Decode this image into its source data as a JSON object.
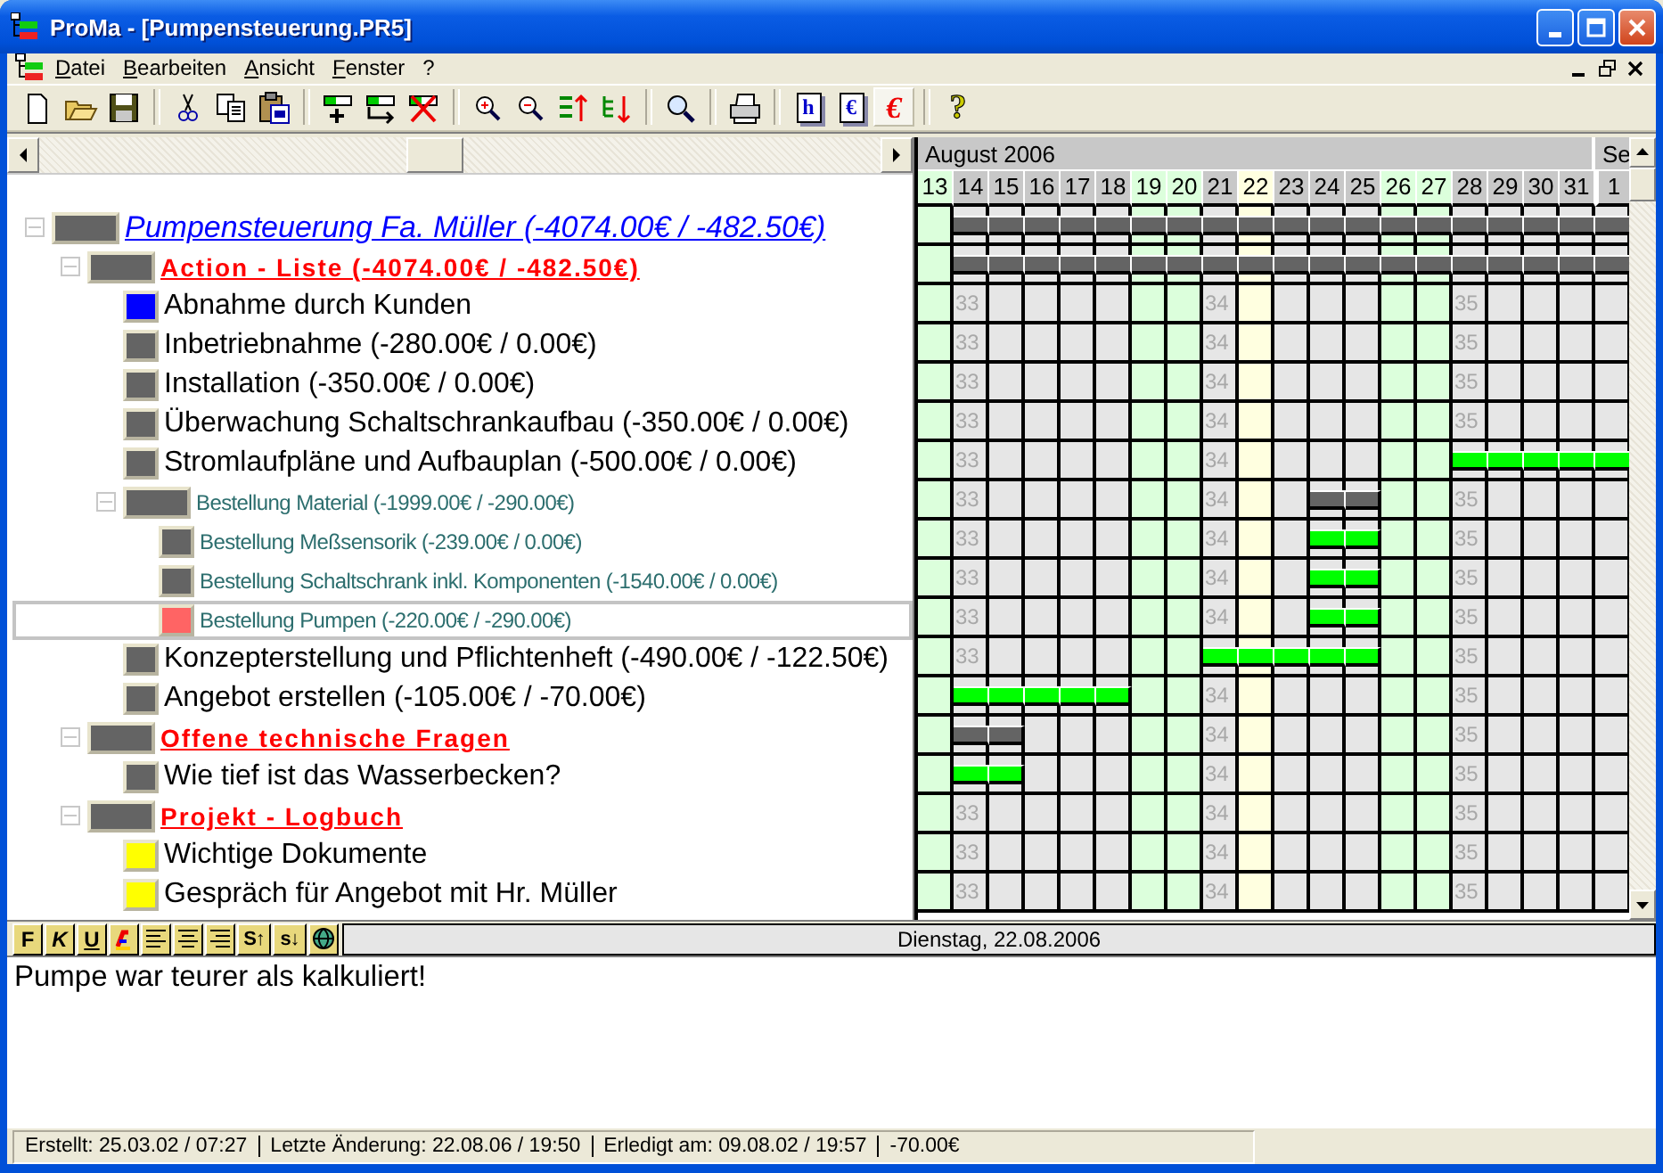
{
  "window": {
    "title": "ProMa - [Pumpensteuerung.PR5]"
  },
  "menu": [
    {
      "label": "Datei"
    },
    {
      "label": "Bearbeiten"
    },
    {
      "label": "Ansicht"
    },
    {
      "label": "Fenster"
    },
    {
      "label": "?"
    }
  ],
  "toolbar": [
    {
      "kind": "new",
      "pressed": false
    },
    {
      "kind": "open",
      "pressed": false
    },
    {
      "kind": "save",
      "pressed": false
    },
    {
      "kind": "separator"
    },
    {
      "kind": "cut",
      "pressed": false
    },
    {
      "kind": "copy",
      "pressed": false
    },
    {
      "kind": "paste",
      "pressed": false
    },
    {
      "kind": "separator"
    },
    {
      "kind": "add",
      "pressed": false
    },
    {
      "kind": "move",
      "pressed": false
    },
    {
      "kind": "delete",
      "pressed": false
    },
    {
      "kind": "separator"
    },
    {
      "kind": "zoom-in",
      "pressed": false
    },
    {
      "kind": "zoom-out",
      "pressed": false
    },
    {
      "kind": "sort-up",
      "pressed": false
    },
    {
      "kind": "sort-down",
      "pressed": false
    },
    {
      "kind": "separator"
    },
    {
      "kind": "find",
      "pressed": false
    },
    {
      "kind": "separator"
    },
    {
      "kind": "print",
      "pressed": false
    },
    {
      "kind": "separator"
    },
    {
      "kind": "report",
      "glyph": "h",
      "pressed": false
    },
    {
      "kind": "report",
      "glyph": "€",
      "pressed": false
    },
    {
      "kind": "currency",
      "glyph": "€",
      "pressed": true
    },
    {
      "kind": "separator"
    },
    {
      "kind": "help",
      "glyph": "?",
      "pressed": false
    }
  ],
  "tree": [
    {
      "label": "Pumpensteuerung Fa. Müller (-4074.00€ / -482.50€)",
      "kind": "project",
      "color": "#646464",
      "expanded": true,
      "selected": false,
      "children": [
        {
          "label": "Action - Liste (-4074.00€ / -482.50€)",
          "kind": "group",
          "color": "#646464",
          "expanded": true,
          "selected": false,
          "children": [
            {
              "label": "Abnahme durch Kunden",
              "kind": "task",
              "color": "#0000ff",
              "selected": false
            },
            {
              "label": "Inbetriebnahme (-280.00€ / 0.00€)",
              "kind": "task",
              "color": "#646464",
              "selected": false
            },
            {
              "label": "Installation (-350.00€ / 0.00€)",
              "kind": "task",
              "color": "#646464",
              "selected": false
            },
            {
              "label": "Überwachung Schaltschrankaufbau (-350.00€ / 0.00€)",
              "kind": "task",
              "color": "#646464",
              "selected": false
            },
            {
              "label": "Stromlaufpläne und Aufbauplan (-500.00€ / 0.00€)",
              "kind": "task",
              "color": "#646464",
              "selected": false
            },
            {
              "label": "Bestellung Material (-1999.00€ / -290.00€)",
              "kind": "subtask",
              "color": "#646464",
              "expanded": true,
              "selected": false,
              "children": [
                {
                  "label": "Bestellung Meßsensorik (-239.00€ / 0.00€)",
                  "kind": "subtask",
                  "color": "#646464",
                  "selected": false
                },
                {
                  "label": "Bestellung Schaltschrank inkl. Komponenten (-1540.00€ / 0.00€)",
                  "kind": "subtask",
                  "color": "#646464",
                  "selected": false
                },
                {
                  "label": "Bestellung Pumpen (-220.00€ / -290.00€)",
                  "kind": "subtask",
                  "color": "#ff6464",
                  "selected": true
                }
              ]
            },
            {
              "label": "Konzepterstellung und Pflichtenheft (-490.00€ / -122.50€)",
              "kind": "task",
              "color": "#646464",
              "selected": false
            },
            {
              "label": "Angebot erstellen (-105.00€ / -70.00€)",
              "kind": "task",
              "color": "#646464",
              "selected": false
            }
          ]
        },
        {
          "label": "Offene technische Fragen",
          "kind": "group",
          "color": "#646464",
          "expanded": true,
          "selected": false,
          "children": [
            {
              "label": "Wie tief ist das Wasserbecken?",
              "kind": "task",
              "color": "#646464",
              "selected": false
            }
          ]
        },
        {
          "label": "Projekt - Logbuch",
          "kind": "group",
          "color": "#646464",
          "expanded": true,
          "selected": false,
          "children": [
            {
              "label": "Wichtige Dokumente",
              "kind": "task",
              "color": "#ffff00",
              "selected": false
            },
            {
              "label": "Gespräch für Angebot mit Hr. Müller",
              "kind": "task",
              "color": "#ffff00",
              "selected": false
            }
          ]
        }
      ]
    }
  ],
  "gantt": {
    "months": [
      {
        "label": "August 2006"
      },
      {
        "label": "Se"
      }
    ],
    "days": [
      {
        "label": "13",
        "kind": "weekend"
      },
      {
        "label": "14",
        "kind": "weekday"
      },
      {
        "label": "15",
        "kind": "weekday"
      },
      {
        "label": "16",
        "kind": "weekday"
      },
      {
        "label": "17",
        "kind": "weekday"
      },
      {
        "label": "18",
        "kind": "weekday"
      },
      {
        "label": "19",
        "kind": "weekend"
      },
      {
        "label": "20",
        "kind": "weekend"
      },
      {
        "label": "21",
        "kind": "weekday"
      },
      {
        "label": "22",
        "kind": "today"
      },
      {
        "label": "23",
        "kind": "weekday"
      },
      {
        "label": "24",
        "kind": "weekday"
      },
      {
        "label": "25",
        "kind": "weekday"
      },
      {
        "label": "26",
        "kind": "weekend"
      },
      {
        "label": "27",
        "kind": "weekend"
      },
      {
        "label": "28",
        "kind": "weekday"
      },
      {
        "label": "29",
        "kind": "weekday"
      },
      {
        "label": "30",
        "kind": "weekday"
      },
      {
        "label": "31",
        "kind": "weekday"
      },
      {
        "label": "1",
        "kind": "weekday",
        "new_month": true
      }
    ],
    "rows": [
      {
        "color": "#646464",
        "cells": [
          {
            "bar": false
          },
          {
            "bar": true
          },
          {
            "bar": true
          },
          {
            "bar": true
          },
          {
            "bar": true
          },
          {
            "bar": true
          },
          {
            "bar": true
          },
          {
            "bar": true
          },
          {
            "bar": true
          },
          {
            "bar": true
          },
          {
            "bar": true
          },
          {
            "bar": true
          },
          {
            "bar": true
          },
          {
            "bar": true
          },
          {
            "bar": true
          },
          {
            "bar": true
          },
          {
            "bar": true
          },
          {
            "bar": true
          },
          {
            "bar": true
          },
          {
            "bar": true
          }
        ]
      },
      {
        "color": "#646464",
        "cells": [
          {
            "bar": false
          },
          {
            "bar": true
          },
          {
            "bar": true
          },
          {
            "bar": true
          },
          {
            "bar": true
          },
          {
            "bar": true
          },
          {
            "bar": true
          },
          {
            "bar": true
          },
          {
            "bar": true
          },
          {
            "bar": true
          },
          {
            "bar": true
          },
          {
            "bar": true
          },
          {
            "bar": true
          },
          {
            "bar": true
          },
          {
            "bar": true
          },
          {
            "bar": true
          },
          {
            "bar": true
          },
          {
            "bar": true
          },
          {
            "bar": true
          },
          {
            "bar": true
          }
        ]
      },
      {
        "cells": [
          {
            "bar": false
          },
          {
            "bar": false,
            "mark": "33"
          },
          {
            "bar": false
          },
          {
            "bar": false
          },
          {
            "bar": false
          },
          {
            "bar": false
          },
          {
            "bar": false
          },
          {
            "bar": false
          },
          {
            "bar": false,
            "mark": "34"
          },
          {
            "bar": false
          },
          {
            "bar": false
          },
          {
            "bar": false
          },
          {
            "bar": false
          },
          {
            "bar": false
          },
          {
            "bar": false
          },
          {
            "bar": false,
            "mark": "35"
          },
          {
            "bar": false
          },
          {
            "bar": false
          },
          {
            "bar": false
          },
          {
            "bar": false
          }
        ]
      },
      {
        "cells": [
          {
            "bar": false
          },
          {
            "bar": false,
            "mark": "33"
          },
          {
            "bar": false
          },
          {
            "bar": false
          },
          {
            "bar": false
          },
          {
            "bar": false
          },
          {
            "bar": false
          },
          {
            "bar": false
          },
          {
            "bar": false,
            "mark": "34"
          },
          {
            "bar": false
          },
          {
            "bar": false
          },
          {
            "bar": false
          },
          {
            "bar": false
          },
          {
            "bar": false
          },
          {
            "bar": false
          },
          {
            "bar": false,
            "mark": "35"
          },
          {
            "bar": false
          },
          {
            "bar": false
          },
          {
            "bar": false
          },
          {
            "bar": false
          }
        ]
      },
      {
        "cells": [
          {
            "bar": false
          },
          {
            "bar": false,
            "mark": "33"
          },
          {
            "bar": false
          },
          {
            "bar": false
          },
          {
            "bar": false
          },
          {
            "bar": false
          },
          {
            "bar": false
          },
          {
            "bar": false
          },
          {
            "bar": false,
            "mark": "34"
          },
          {
            "bar": false
          },
          {
            "bar": false
          },
          {
            "bar": false
          },
          {
            "bar": false
          },
          {
            "bar": false
          },
          {
            "bar": false
          },
          {
            "bar": false,
            "mark": "35"
          },
          {
            "bar": false
          },
          {
            "bar": false
          },
          {
            "bar": false
          },
          {
            "bar": false
          }
        ]
      },
      {
        "cells": [
          {
            "bar": false
          },
          {
            "bar": false,
            "mark": "33"
          },
          {
            "bar": false
          },
          {
            "bar": false
          },
          {
            "bar": false
          },
          {
            "bar": false
          },
          {
            "bar": false
          },
          {
            "bar": false
          },
          {
            "bar": false,
            "mark": "34"
          },
          {
            "bar": false
          },
          {
            "bar": false
          },
          {
            "bar": false
          },
          {
            "bar": false
          },
          {
            "bar": false
          },
          {
            "bar": false
          },
          {
            "bar": false,
            "mark": "35"
          },
          {
            "bar": false
          },
          {
            "bar": false
          },
          {
            "bar": false
          },
          {
            "bar": false
          }
        ]
      },
      {
        "color": "#00ff00",
        "cells": [
          {
            "bar": false
          },
          {
            "bar": false,
            "mark": "33"
          },
          {
            "bar": false
          },
          {
            "bar": false
          },
          {
            "bar": false
          },
          {
            "bar": false
          },
          {
            "bar": false
          },
          {
            "bar": false
          },
          {
            "bar": false,
            "mark": "34"
          },
          {
            "bar": false
          },
          {
            "bar": false
          },
          {
            "bar": false
          },
          {
            "bar": false
          },
          {
            "bar": false
          },
          {
            "bar": false
          },
          {
            "bar": true
          },
          {
            "bar": true
          },
          {
            "bar": true
          },
          {
            "bar": true
          },
          {
            "bar": true
          }
        ]
      },
      {
        "color": "#646464",
        "cells": [
          {
            "bar": false
          },
          {
            "bar": false,
            "mark": "33"
          },
          {
            "bar": false
          },
          {
            "bar": false
          },
          {
            "bar": false
          },
          {
            "bar": false
          },
          {
            "bar": false
          },
          {
            "bar": false
          },
          {
            "bar": false,
            "mark": "34"
          },
          {
            "bar": false
          },
          {
            "bar": false
          },
          {
            "bar": true
          },
          {
            "bar": true
          },
          {
            "bar": false
          },
          {
            "bar": false
          },
          {
            "bar": false,
            "mark": "35"
          },
          {
            "bar": false
          },
          {
            "bar": false
          },
          {
            "bar": false
          },
          {
            "bar": false
          }
        ]
      },
      {
        "color": "#00ff00",
        "cells": [
          {
            "bar": false
          },
          {
            "bar": false,
            "mark": "33"
          },
          {
            "bar": false
          },
          {
            "bar": false
          },
          {
            "bar": false
          },
          {
            "bar": false
          },
          {
            "bar": false
          },
          {
            "bar": false
          },
          {
            "bar": false,
            "mark": "34"
          },
          {
            "bar": false
          },
          {
            "bar": false
          },
          {
            "bar": true
          },
          {
            "bar": true
          },
          {
            "bar": false
          },
          {
            "bar": false
          },
          {
            "bar": false,
            "mark": "35"
          },
          {
            "bar": false
          },
          {
            "bar": false
          },
          {
            "bar": false
          },
          {
            "bar": false
          }
        ]
      },
      {
        "color": "#00ff00",
        "cells": [
          {
            "bar": false
          },
          {
            "bar": false,
            "mark": "33"
          },
          {
            "bar": false
          },
          {
            "bar": false
          },
          {
            "bar": false
          },
          {
            "bar": false
          },
          {
            "bar": false
          },
          {
            "bar": false
          },
          {
            "bar": false,
            "mark": "34"
          },
          {
            "bar": false
          },
          {
            "bar": false
          },
          {
            "bar": true
          },
          {
            "bar": true
          },
          {
            "bar": false
          },
          {
            "bar": false
          },
          {
            "bar": false,
            "mark": "35"
          },
          {
            "bar": false
          },
          {
            "bar": false
          },
          {
            "bar": false
          },
          {
            "bar": false
          }
        ]
      },
      {
        "color": "#00ff00",
        "cells": [
          {
            "bar": false
          },
          {
            "bar": false,
            "mark": "33"
          },
          {
            "bar": false
          },
          {
            "bar": false
          },
          {
            "bar": false
          },
          {
            "bar": false
          },
          {
            "bar": false
          },
          {
            "bar": false
          },
          {
            "bar": false,
            "mark": "34"
          },
          {
            "bar": false
          },
          {
            "bar": false
          },
          {
            "bar": true
          },
          {
            "bar": true
          },
          {
            "bar": false
          },
          {
            "bar": false
          },
          {
            "bar": false,
            "mark": "35"
          },
          {
            "bar": false
          },
          {
            "bar": false
          },
          {
            "bar": false
          },
          {
            "bar": false
          }
        ]
      },
      {
        "color": "#00ff00",
        "cells": [
          {
            "bar": false
          },
          {
            "bar": false,
            "mark": "33"
          },
          {
            "bar": false
          },
          {
            "bar": false
          },
          {
            "bar": false
          },
          {
            "bar": false
          },
          {
            "bar": false
          },
          {
            "bar": false
          },
          {
            "bar": true
          },
          {
            "bar": true
          },
          {
            "bar": true
          },
          {
            "bar": true
          },
          {
            "bar": true
          },
          {
            "bar": false
          },
          {
            "bar": false
          },
          {
            "bar": false,
            "mark": "35"
          },
          {
            "bar": false
          },
          {
            "bar": false
          },
          {
            "bar": false
          },
          {
            "bar": false
          }
        ]
      },
      {
        "color": "#00ff00",
        "cells": [
          {
            "bar": false
          },
          {
            "bar": true
          },
          {
            "bar": true
          },
          {
            "bar": true
          },
          {
            "bar": true
          },
          {
            "bar": true
          },
          {
            "bar": false
          },
          {
            "bar": false
          },
          {
            "bar": false,
            "mark": "34"
          },
          {
            "bar": false
          },
          {
            "bar": false
          },
          {
            "bar": false
          },
          {
            "bar": false
          },
          {
            "bar": false
          },
          {
            "bar": false
          },
          {
            "bar": false,
            "mark": "35"
          },
          {
            "bar": false
          },
          {
            "bar": false
          },
          {
            "bar": false
          },
          {
            "bar": false
          }
        ]
      },
      {
        "color": "#646464",
        "cells": [
          {
            "bar": false
          },
          {
            "bar": true
          },
          {
            "bar": true
          },
          {
            "bar": false
          },
          {
            "bar": false
          },
          {
            "bar": false
          },
          {
            "bar": false
          },
          {
            "bar": false
          },
          {
            "bar": false,
            "mark": "34"
          },
          {
            "bar": false
          },
          {
            "bar": false
          },
          {
            "bar": false
          },
          {
            "bar": false
          },
          {
            "bar": false
          },
          {
            "bar": false
          },
          {
            "bar": false,
            "mark": "35"
          },
          {
            "bar": false
          },
          {
            "bar": false
          },
          {
            "bar": false
          },
          {
            "bar": false
          }
        ]
      },
      {
        "color": "#00ff00",
        "cells": [
          {
            "bar": false
          },
          {
            "bar": true
          },
          {
            "bar": true
          },
          {
            "bar": false
          },
          {
            "bar": false
          },
          {
            "bar": false
          },
          {
            "bar": false
          },
          {
            "bar": false
          },
          {
            "bar": false,
            "mark": "34"
          },
          {
            "bar": false
          },
          {
            "bar": false
          },
          {
            "bar": false
          },
          {
            "bar": false
          },
          {
            "bar": false
          },
          {
            "bar": false
          },
          {
            "bar": false,
            "mark": "35"
          },
          {
            "bar": false
          },
          {
            "bar": false
          },
          {
            "bar": false
          },
          {
            "bar": false
          }
        ]
      },
      {
        "cells": [
          {
            "bar": false
          },
          {
            "bar": false,
            "mark": "33"
          },
          {
            "bar": false
          },
          {
            "bar": false
          },
          {
            "bar": false
          },
          {
            "bar": false
          },
          {
            "bar": false
          },
          {
            "bar": false
          },
          {
            "bar": false,
            "mark": "34"
          },
          {
            "bar": false
          },
          {
            "bar": false
          },
          {
            "bar": false
          },
          {
            "bar": false
          },
          {
            "bar": false
          },
          {
            "bar": false
          },
          {
            "bar": false,
            "mark": "35"
          },
          {
            "bar": false
          },
          {
            "bar": false
          },
          {
            "bar": false
          },
          {
            "bar": false
          }
        ]
      },
      {
        "cells": [
          {
            "bar": false
          },
          {
            "bar": false,
            "mark": "33"
          },
          {
            "bar": false
          },
          {
            "bar": false
          },
          {
            "bar": false
          },
          {
            "bar": false
          },
          {
            "bar": false
          },
          {
            "bar": false
          },
          {
            "bar": false,
            "mark": "34"
          },
          {
            "bar": false
          },
          {
            "bar": false
          },
          {
            "bar": false
          },
          {
            "bar": false
          },
          {
            "bar": false
          },
          {
            "bar": false
          },
          {
            "bar": false,
            "mark": "35"
          },
          {
            "bar": false
          },
          {
            "bar": false
          },
          {
            "bar": false
          },
          {
            "bar": false
          }
        ]
      },
      {
        "cells": [
          {
            "bar": false
          },
          {
            "bar": false,
            "mark": "33"
          },
          {
            "bar": false
          },
          {
            "bar": false
          },
          {
            "bar": false
          },
          {
            "bar": false
          },
          {
            "bar": false
          },
          {
            "bar": false
          },
          {
            "bar": false,
            "mark": "34"
          },
          {
            "bar": false
          },
          {
            "bar": false
          },
          {
            "bar": false
          },
          {
            "bar": false
          },
          {
            "bar": false
          },
          {
            "bar": false
          },
          {
            "bar": false,
            "mark": "35"
          },
          {
            "bar": false
          },
          {
            "bar": false
          },
          {
            "bar": false
          },
          {
            "bar": false
          }
        ]
      }
    ]
  },
  "editor": {
    "format_buttons": [
      {
        "kind": "bold",
        "label": "F"
      },
      {
        "kind": "italic",
        "label": "K"
      },
      {
        "kind": "underline",
        "label": "U"
      },
      {
        "kind": "color"
      },
      {
        "kind": "align-left"
      },
      {
        "kind": "align-center"
      },
      {
        "kind": "align-right"
      },
      {
        "kind": "bold",
        "label": "S↑"
      },
      {
        "kind": "bold",
        "label": "s↓"
      },
      {
        "kind": "web"
      }
    ],
    "date": "Dienstag, 22.08.2006",
    "text": "Pumpe war teurer als kalkuliert!"
  },
  "status_bar": [
    "Erstellt: 25.03.02 / 07:27",
    "Letzte Änderung: 22.08.06 / 19:50",
    "Erledigt am: 09.08.02 / 19:57",
    "-70.00€"
  ]
}
